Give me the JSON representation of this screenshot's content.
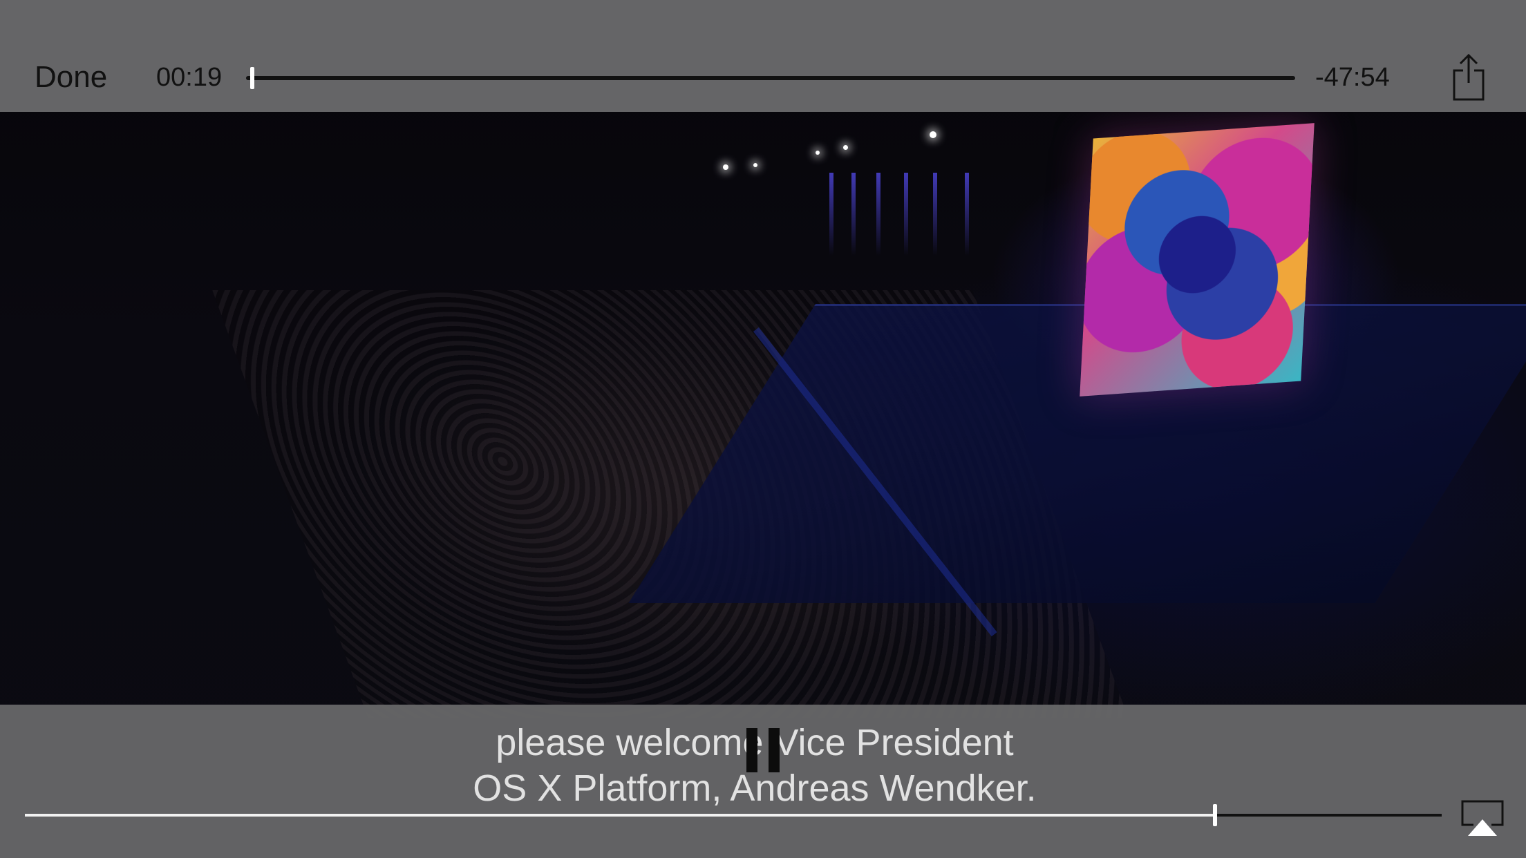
{
  "player": {
    "done_label": "Done",
    "time_elapsed": "00:19",
    "time_remaining": "-47:54",
    "playback_progress": 0.004,
    "volume_level": 0.84
  },
  "subtitles": {
    "line1": "please welcome Vice President",
    "line2": "OS X Platform, Andreas Wendker."
  },
  "icons": {
    "share": "share-icon",
    "pause": "pause-icon",
    "airplay": "airplay-icon"
  },
  "colors": {
    "bar_bg": "#69696b",
    "control_dark": "#111111",
    "subtitle_text": "#e2e2e2",
    "thumb": "#ffffff"
  }
}
